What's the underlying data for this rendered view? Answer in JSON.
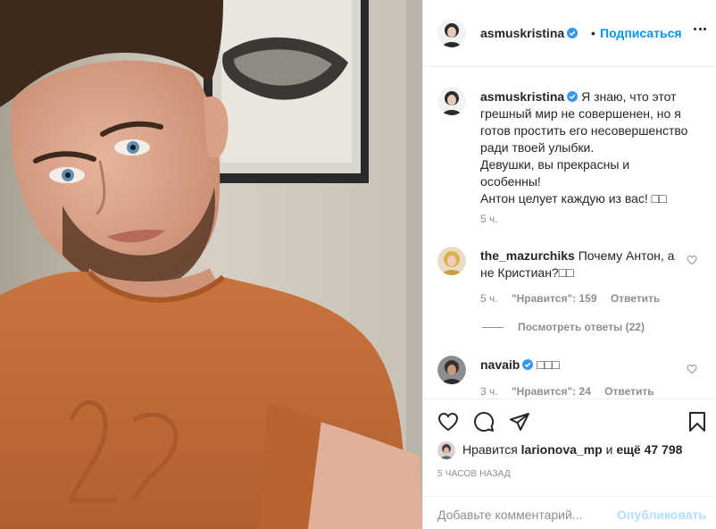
{
  "post": {
    "author": "asmuskristina",
    "follow_label": "Подписаться",
    "header_separator": "•",
    "verified_icon": "verified-badge-icon",
    "accent_color": "#0095f6"
  },
  "caption": {
    "username": "asmuskristina",
    "lines": [
      "Я знаю, что этот",
      "грешный мир не совершенен, но я",
      "готов простить его несовершенство",
      "ради твоей улыбки.",
      "Девушки, вы прекрасны и",
      "особенны!",
      "Антон целует каждую из вас! □□"
    ],
    "time": "5 ч."
  },
  "comments": [
    {
      "username": "the_mazurchiks",
      "text_line1": "Почему Антон, а",
      "text_line2": "не Кристиан?□□",
      "time": "5 ч.",
      "likes": "\"Нравится\": 159",
      "reply": "Ответить",
      "view_replies": "Посмотреть ответы (22)"
    },
    {
      "username": "navaib",
      "text": "□□□",
      "time": "3 ч.",
      "likes": "\"Нравится\": 24",
      "reply": "Ответить"
    }
  ],
  "likes": {
    "prefix": "Нравится",
    "user": "larionova_mp",
    "mid": "и",
    "count": "ещё 47 798"
  },
  "date": "5 ЧАСОВ НАЗАД",
  "add_comment": {
    "placeholder": "Добавьте комментарий...",
    "publish_label": "Опубликовать"
  }
}
